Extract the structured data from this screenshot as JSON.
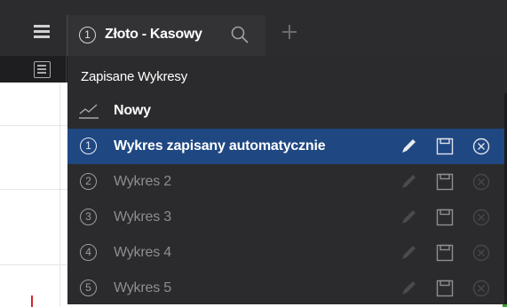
{
  "tab": {
    "number": "1",
    "label": "Złoto - Kasowy"
  },
  "menu": {
    "title": "Zapisane Wykresy",
    "new_label": "Nowy",
    "items": [
      {
        "number": "1",
        "label": "Wykres zapisany automatycznie",
        "active": true
      },
      {
        "number": "2",
        "label": "Wykres 2",
        "active": false
      },
      {
        "number": "3",
        "label": "Wykres 3",
        "active": false
      },
      {
        "number": "4",
        "label": "Wykres 4",
        "active": false
      },
      {
        "number": "5",
        "label": "Wykres 5",
        "active": false
      }
    ]
  },
  "icons": {
    "menu": "hamburger-icon",
    "search": "search-icon",
    "add_tab": "plus-icon",
    "list": "list-icon",
    "new_chart": "chart-line-icon",
    "edit": "pencil-icon",
    "save": "save-icon",
    "delete": "close-circle-icon"
  },
  "colors": {
    "topbar": "#2c2c2e",
    "menu_bg": "#2b2b2d",
    "active_item": "#1f4782",
    "text_primary": "#ffffff",
    "text_muted": "#8d8e92"
  }
}
